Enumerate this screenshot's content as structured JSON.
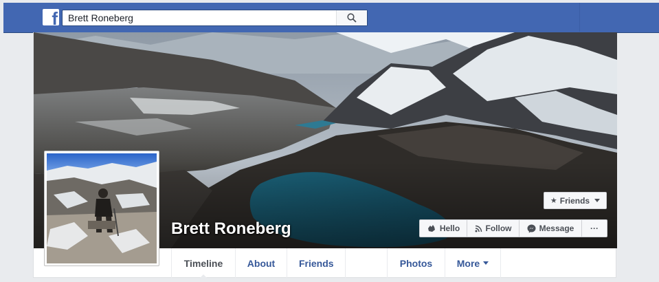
{
  "topbar": {
    "logo_glyph": "f",
    "search": {
      "value": "Brett Roneberg",
      "placeholder": "Search"
    },
    "brand_color": "#4267b2"
  },
  "profile": {
    "name": "Brett Roneberg",
    "friends_button": {
      "label": "Friends",
      "icon": "star-icon"
    },
    "actions": [
      {
        "label": "Hello",
        "icon": "wave-icon"
      },
      {
        "label": "Follow",
        "icon": "rss-icon"
      },
      {
        "label": "Message",
        "icon": "messenger-icon"
      },
      {
        "label": "···",
        "icon": "more-dots"
      }
    ]
  },
  "nav": {
    "tabs": [
      {
        "label": "Timeline",
        "active": true
      },
      {
        "label": "About"
      },
      {
        "label": "Friends"
      },
      {
        "label": ""
      },
      {
        "label": "Photos"
      },
      {
        "label": "More",
        "has_dropdown": true
      }
    ]
  },
  "colors": {
    "link": "#365899",
    "lake": "#1e6f8a",
    "page_background": "#e9ebee"
  }
}
